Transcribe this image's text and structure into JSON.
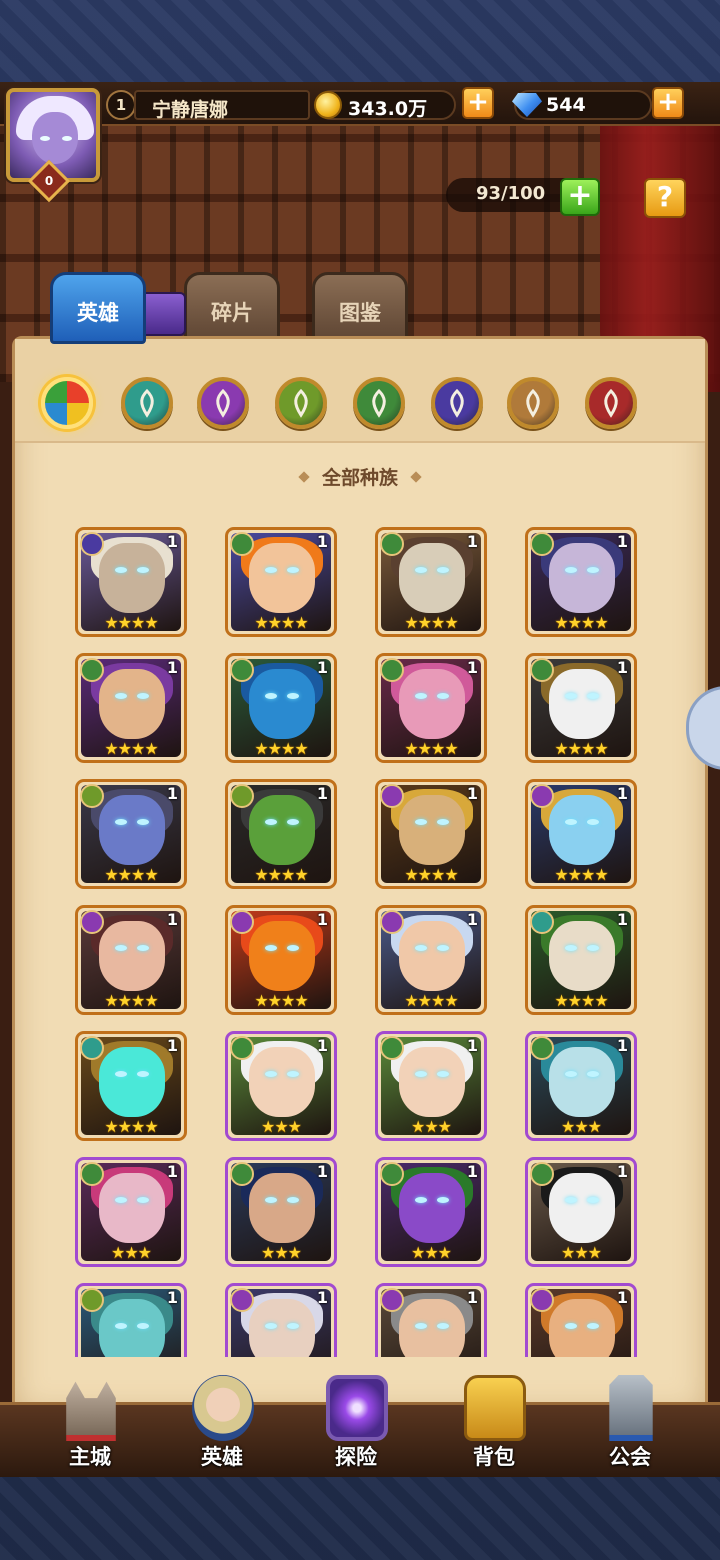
{
  "player": {
    "level": "1",
    "name": "宁静唐娜",
    "avatar_badge": "0"
  },
  "resources": {
    "gold": "343.0万",
    "diamonds": "544"
  },
  "hero_capacity": "93/100",
  "help_label": "?",
  "tabs": [
    {
      "label": "英雄",
      "active": true
    },
    {
      "label": "碎片",
      "active": false
    },
    {
      "label": "图鉴",
      "active": false
    }
  ],
  "factions": [
    {
      "name": "all-factions-icon",
      "selected": true
    },
    {
      "name": "forest-faction-icon",
      "color": "#2f9c8c"
    },
    {
      "name": "shadow-faction-icon",
      "color": "#8a3ab0"
    },
    {
      "name": "fortress-faction-icon",
      "color": "#6f9a2a"
    },
    {
      "name": "nature-faction-icon",
      "color": "#3f8a3a"
    },
    {
      "name": "abyss-faction-icon",
      "color": "#4a3aa0"
    },
    {
      "name": "dark-faction-icon",
      "color": "#b07a3a"
    },
    {
      "name": "light-faction-icon",
      "color": "#a82a2a"
    }
  ],
  "section_title": "全部种族",
  "heroes": [
    {
      "level": "1",
      "stars": "★★★★",
      "frame": "orange",
      "race_color": "#4a3aa0",
      "bg": "#6a5a9a",
      "skin": "#c7b29a",
      "hair": "#e8e0d0"
    },
    {
      "level": "1",
      "stars": "★★★★",
      "frame": "orange",
      "race_color": "#3f8a3a",
      "bg": "#4a4aa0",
      "skin": "#f2c49a",
      "hair": "#f07a1a"
    },
    {
      "level": "1",
      "stars": "★★★★",
      "frame": "orange",
      "race_color": "#3f8a3a",
      "bg": "#7a5a3a",
      "skin": "#d8cdb8",
      "hair": "#5a4030"
    },
    {
      "level": "1",
      "stars": "★★★★",
      "frame": "orange",
      "race_color": "#3f8a3a",
      "bg": "#3a2a5a",
      "skin": "#c6b6d8",
      "hair": "#3a3a7a"
    },
    {
      "level": "1",
      "stars": "★★★★",
      "frame": "orange",
      "race_color": "#3f8a3a",
      "bg": "#5a2a7a",
      "skin": "#e3b48a",
      "hair": "#7a3aa0"
    },
    {
      "level": "1",
      "stars": "★★★★",
      "frame": "orange",
      "race_color": "#3f8a3a",
      "bg": "#2a5a3a",
      "skin": "#2a8ad0",
      "hair": "#1a5aa0"
    },
    {
      "level": "1",
      "stars": "★★★★",
      "frame": "orange",
      "race_color": "#3f8a3a",
      "bg": "#6a2a4a",
      "skin": "#e89ab8",
      "hair": "#d05a9a"
    },
    {
      "level": "1",
      "stars": "★★★★",
      "frame": "orange",
      "race_color": "#3f8a3a",
      "bg": "#3a3a3a",
      "skin": "#f0f0f0",
      "hair": "#8a6a2a"
    },
    {
      "level": "1",
      "stars": "★★★★",
      "frame": "orange",
      "race_color": "#6f9a2a",
      "bg": "#3a3a4a",
      "skin": "#6a7ac8",
      "hair": "#4a4a6a"
    },
    {
      "level": "1",
      "stars": "★★★★",
      "frame": "orange",
      "race_color": "#6f9a2a",
      "bg": "#2a2a2a",
      "skin": "#5aa03a",
      "hair": "#3a3a3a"
    },
    {
      "level": "1",
      "stars": "★★★★",
      "frame": "orange",
      "race_color": "#8a3ab0",
      "bg": "#5a3a1a",
      "skin": "#d8b07a",
      "hair": "#d8a83a"
    },
    {
      "level": "1",
      "stars": "★★★★",
      "frame": "orange",
      "race_color": "#8a3ab0",
      "bg": "#2a3a6a",
      "skin": "#8ad0f0",
      "hair": "#d8a83a"
    },
    {
      "level": "1",
      "stars": "★★★★",
      "frame": "orange",
      "race_color": "#8a3ab0",
      "bg": "#5a3a3a",
      "skin": "#e8b8a0",
      "hair": "#5a2a2a"
    },
    {
      "level": "1",
      "stars": "★★★★",
      "frame": "orange",
      "race_color": "#8a3ab0",
      "bg": "#c03a1a",
      "skin": "#f0801a",
      "hair": "#e84a1a"
    },
    {
      "level": "1",
      "stars": "★★★★",
      "frame": "orange",
      "race_color": "#8a3ab0",
      "bg": "#4a5a8a",
      "skin": "#f0c8a8",
      "hair": "#c8d8f0"
    },
    {
      "level": "1",
      "stars": "★★★★",
      "frame": "orange",
      "race_color": "#2f9c8c",
      "bg": "#2a5a2a",
      "skin": "#e8dcc8",
      "hair": "#3a7a2a"
    },
    {
      "level": "1",
      "stars": "★★★★",
      "frame": "orange",
      "race_color": "#2f9c8c",
      "bg": "#6a4a1a",
      "skin": "#4ae8d8",
      "hair": "#a07a2a"
    },
    {
      "level": "1",
      "stars": "★★★",
      "frame": "purple",
      "race_color": "#3f8a3a",
      "bg": "#5a8a3a",
      "skin": "#f2d2b8",
      "hair": "#f0f0f0"
    },
    {
      "level": "1",
      "stars": "★★★",
      "frame": "purple",
      "race_color": "#3f8a3a",
      "bg": "#5a8a3a",
      "skin": "#f2d2b8",
      "hair": "#f0f0f0"
    },
    {
      "level": "1",
      "stars": "★★★",
      "frame": "purple",
      "race_color": "#3f8a3a",
      "bg": "#2a4a5a",
      "skin": "#b8e0e8",
      "hair": "#2a8a9a"
    },
    {
      "level": "1",
      "stars": "★★★",
      "frame": "purple",
      "race_color": "#3f8a3a",
      "bg": "#5a2a5a",
      "skin": "#e8b8c8",
      "hair": "#c83a7a"
    },
    {
      "level": "1",
      "stars": "★★★",
      "frame": "purple",
      "race_color": "#3f8a3a",
      "bg": "#2a3a5a",
      "skin": "#d8a888",
      "hair": "#1a2a5a"
    },
    {
      "level": "1",
      "stars": "★★★",
      "frame": "purple",
      "race_color": "#3f8a3a",
      "bg": "#4a2a6a",
      "skin": "#8a4ac8",
      "hair": "#2a7a2a"
    },
    {
      "level": "1",
      "stars": "★★★",
      "frame": "purple",
      "race_color": "#3f8a3a",
      "bg": "#6a5a4a",
      "skin": "#f0f0f0",
      "hair": "#1a1a1a"
    },
    {
      "level": "1",
      "stars": "★★★",
      "frame": "purple",
      "race_color": "#6f9a2a",
      "bg": "#2a5a7a",
      "skin": "#6ac8c8",
      "hair": "#3a8a8a"
    },
    {
      "level": "1",
      "stars": "★★★",
      "frame": "purple",
      "race_color": "#8a3ab0",
      "bg": "#3a3a6a",
      "skin": "#e8d0c0",
      "hair": "#d8d8e8"
    },
    {
      "level": "1",
      "stars": "★★★",
      "frame": "purple",
      "race_color": "#8a3ab0",
      "bg": "#5a4a3a",
      "skin": "#e8c0a0",
      "hair": "#8a8a8a"
    },
    {
      "level": "1",
      "stars": "★★★",
      "frame": "purple",
      "race_color": "#8a3ab0",
      "bg": "#5a3a2a",
      "skin": "#e8b080",
      "hair": "#d07a2a"
    }
  ],
  "bottom_nav": [
    {
      "label": "主城",
      "icon": "castle-icon"
    },
    {
      "label": "英雄",
      "icon": "hero-icon"
    },
    {
      "label": "探险",
      "icon": "portal-icon"
    },
    {
      "label": "背包",
      "icon": "backpack-icon"
    },
    {
      "label": "公会",
      "icon": "guild-tower-icon"
    }
  ]
}
